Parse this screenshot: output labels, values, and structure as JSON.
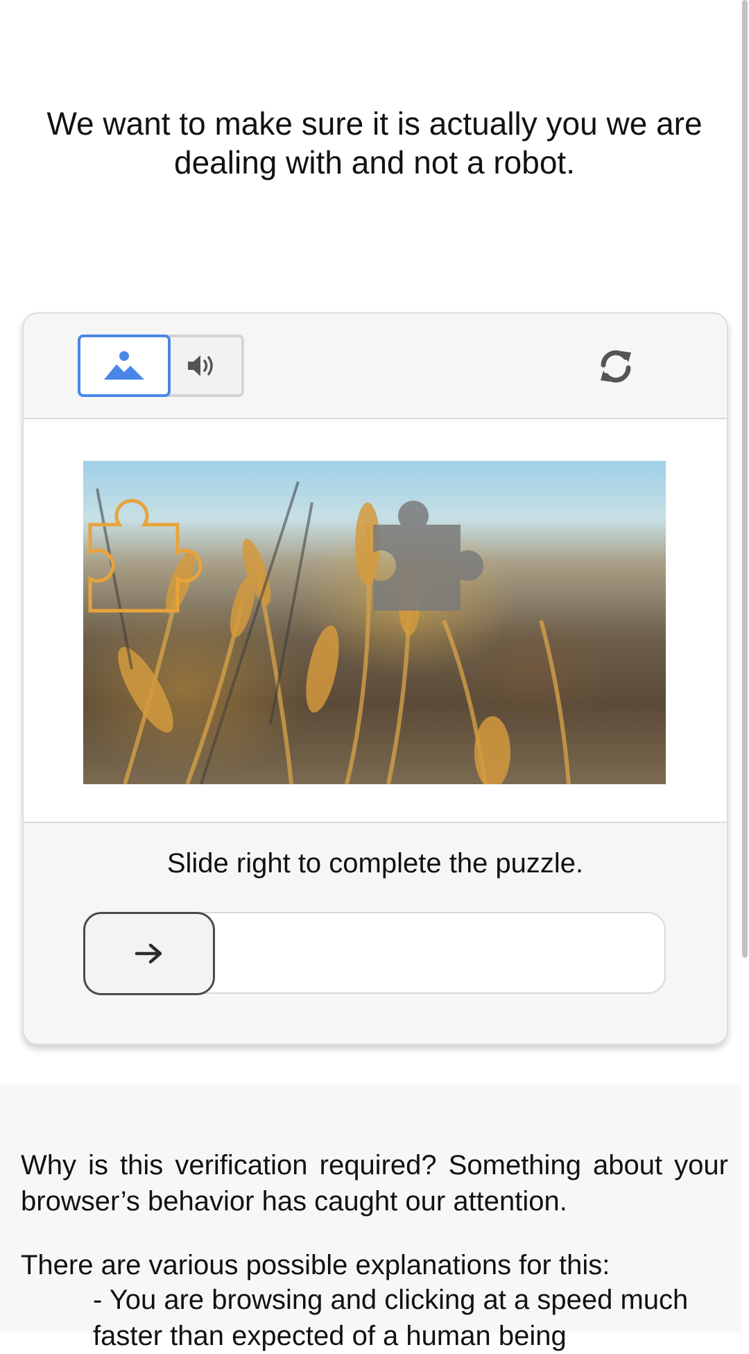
{
  "intro": {
    "heading": "We want to make sure it is actually you we are dealing with and not a robot."
  },
  "captcha": {
    "modes": [
      {
        "name": "image-mode",
        "icon": "image-icon",
        "selected": true
      },
      {
        "name": "audio-mode",
        "icon": "speaker-icon",
        "selected": false
      }
    ],
    "refresh_icon": "refresh-icon",
    "image_description": "wheat-field-puzzle",
    "instruction": "Slide right to complete the puzzle.",
    "slider": {
      "icon": "arrow-right-icon",
      "progress": 0
    },
    "colors": {
      "accent": "#4a86e8",
      "target_outline": "#e8a33a",
      "piece_fill": "#7a7a7a"
    }
  },
  "info": {
    "why": "Why is this verification required? Something about your browser’s behavior has caught our attention.",
    "explanations_title": "There are various possible explanations for this:",
    "explanations": [
      "- You are browsing and clicking at a speed much faster than expected of a human being"
    ]
  }
}
